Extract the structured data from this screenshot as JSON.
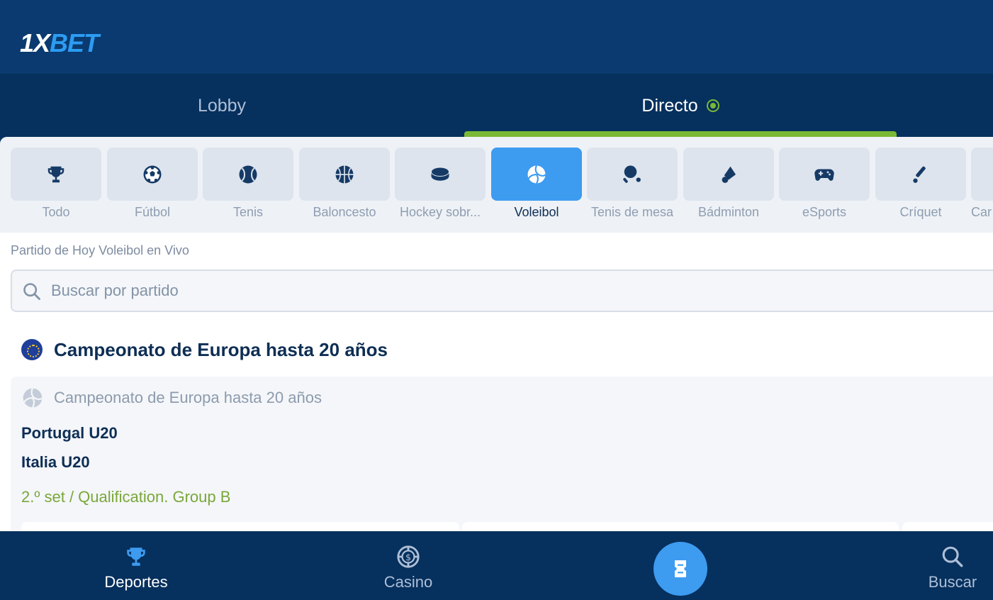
{
  "header": {
    "logo_part1": "1X",
    "logo_part2": "BET"
  },
  "tabs": [
    {
      "label": "Lobby",
      "active": false
    },
    {
      "label": "Directo",
      "active": true,
      "live_indicator": true
    }
  ],
  "sports": [
    {
      "label": "Todo",
      "icon": "trophy-icon"
    },
    {
      "label": "Fútbol",
      "icon": "soccer-ball-icon"
    },
    {
      "label": "Tenis",
      "icon": "tennis-ball-icon"
    },
    {
      "label": "Baloncesto",
      "icon": "basketball-icon"
    },
    {
      "label": "Hockey sobr...",
      "icon": "hockey-puck-icon"
    },
    {
      "label": "Voleibol",
      "icon": "volleyball-icon",
      "active": true
    },
    {
      "label": "Tenis de mesa",
      "icon": "table-tennis-icon"
    },
    {
      "label": "Bádminton",
      "icon": "shuttlecock-icon"
    },
    {
      "label": "eSports",
      "icon": "gamepad-icon"
    },
    {
      "label": "Críquet",
      "icon": "cricket-bat-icon"
    },
    {
      "label": "Car",
      "icon": "sport-icon"
    }
  ],
  "page_title": "Partido de Hoy Voleibol en Vivo",
  "search": {
    "placeholder": "Buscar por partido"
  },
  "league": {
    "title": "Campeonato de Europa hasta 20 años",
    "flag_icon": "eu-flag-icon"
  },
  "match": {
    "league_label": "Campeonato de Europa hasta 20 años",
    "team1": "Portugal U20",
    "team2": "Italia U20",
    "status": "2.º set / Qualification. Group B"
  },
  "bottom_nav": {
    "deportes": "Deportes",
    "casino": "Casino",
    "buscar": "Buscar"
  },
  "colors": {
    "accent_blue": "#3d9bf0",
    "live_green": "#7ab935",
    "navy": "#06305d"
  }
}
